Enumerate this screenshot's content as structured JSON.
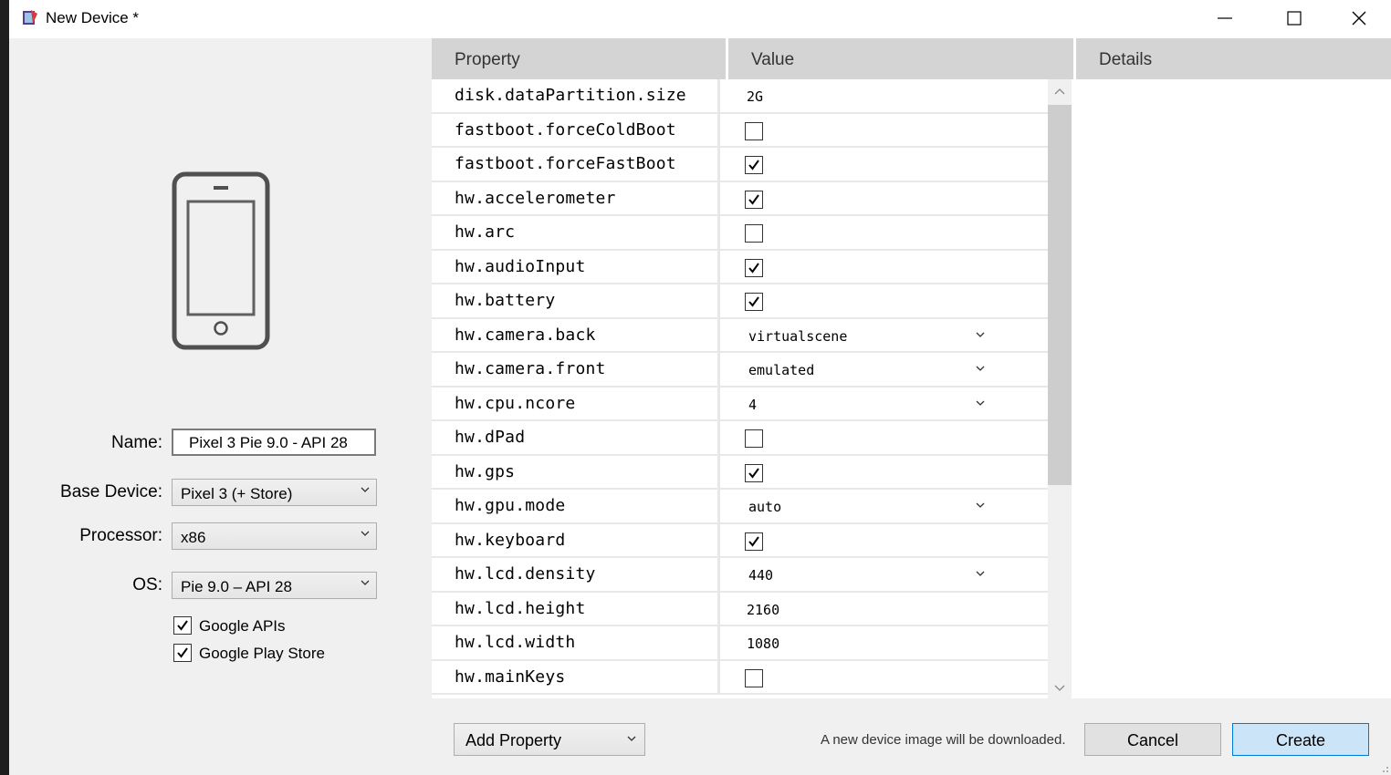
{
  "window": {
    "title": "New Device *",
    "icons": [
      "app-icon",
      "minimize-icon",
      "maximize-icon",
      "close-icon"
    ]
  },
  "device_image": {
    "icon": "phone-icon"
  },
  "form": {
    "name_label": "Name:",
    "name_value": "Pixel 3 Pie 9.0 - API 28",
    "base_device_label": "Base Device:",
    "base_device_value": "Pixel 3 (+ Store)",
    "processor_label": "Processor:",
    "processor_value": "x86",
    "os_label": "OS:",
    "os_value": "Pie 9.0 – API 28",
    "google_apis_label": "Google APIs",
    "google_apis_checked": true,
    "google_play_label": "Google Play Store",
    "google_play_checked": true
  },
  "grid": {
    "headers": {
      "property": "Property",
      "value": "Value",
      "details": "Details"
    },
    "rows": [
      {
        "property": "disk.dataPartition.size",
        "type": "text",
        "value": "2G"
      },
      {
        "property": "fastboot.forceColdBoot",
        "type": "checkbox",
        "checked": false
      },
      {
        "property": "fastboot.forceFastBoot",
        "type": "checkbox",
        "checked": true
      },
      {
        "property": "hw.accelerometer",
        "type": "checkbox",
        "checked": true
      },
      {
        "property": "hw.arc",
        "type": "checkbox",
        "checked": false
      },
      {
        "property": "hw.audioInput",
        "type": "checkbox",
        "checked": true
      },
      {
        "property": "hw.battery",
        "type": "checkbox",
        "checked": true
      },
      {
        "property": "hw.camera.back",
        "type": "combo",
        "value": "virtualscene"
      },
      {
        "property": "hw.camera.front",
        "type": "combo",
        "value": "emulated"
      },
      {
        "property": "hw.cpu.ncore",
        "type": "combo",
        "value": "4"
      },
      {
        "property": "hw.dPad",
        "type": "checkbox",
        "checked": false
      },
      {
        "property": "hw.gps",
        "type": "checkbox",
        "checked": true
      },
      {
        "property": "hw.gpu.mode",
        "type": "combo",
        "value": "auto"
      },
      {
        "property": "hw.keyboard",
        "type": "checkbox",
        "checked": true
      },
      {
        "property": "hw.lcd.density",
        "type": "combo",
        "value": "440"
      },
      {
        "property": "hw.lcd.height",
        "type": "text",
        "value": "2160"
      },
      {
        "property": "hw.lcd.width",
        "type": "text",
        "value": "1080"
      },
      {
        "property": "hw.mainKeys",
        "type": "checkbox",
        "checked": false
      }
    ]
  },
  "footer": {
    "add_property_label": "Add Property",
    "status_text": "A new device image will be downloaded.",
    "cancel_label": "Cancel",
    "create_label": "Create"
  }
}
